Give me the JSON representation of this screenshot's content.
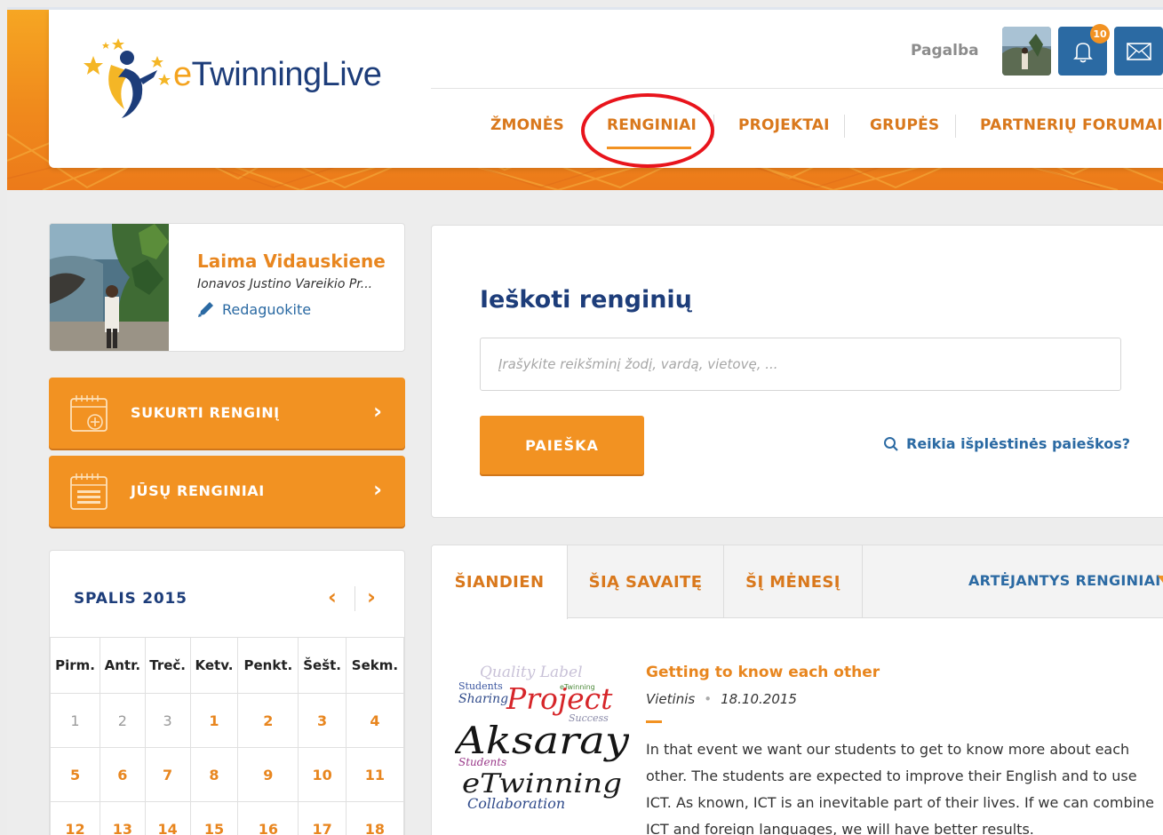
{
  "header": {
    "logo_text_e": "e",
    "logo_text_rest": "TwinningLive",
    "help_link": "Pagalba",
    "notification_count": "10"
  },
  "nav": {
    "items": [
      {
        "label": "ŽMONĖS"
      },
      {
        "label": "RENGINIAI"
      },
      {
        "label": "PROJEKTAI"
      },
      {
        "label": "GRUPĖS"
      },
      {
        "label": "PARTNERIŲ FORUMAI"
      }
    ],
    "active_index": 1
  },
  "profile": {
    "name": "Laima Vidauskiene",
    "school": "Ionavos Justino Vareikio Pr...",
    "edit_label": "Redaguokite"
  },
  "actions": {
    "create_event": "SUKURTI RENGINĮ",
    "your_events": "JŪSŲ RENGINIAI"
  },
  "calendar": {
    "title": "SPALIS 2015",
    "weekdays": [
      "Pirm.",
      "Antr.",
      "Treč.",
      "Ketv.",
      "Penkt.",
      "Šešt.",
      "Sekm."
    ],
    "weeks": [
      [
        {
          "d": "1",
          "m": true
        },
        {
          "d": "2",
          "m": true
        },
        {
          "d": "3",
          "m": true
        },
        {
          "d": "1",
          "m": false
        },
        {
          "d": "2",
          "m": false
        },
        {
          "d": "3",
          "m": false
        },
        {
          "d": "4",
          "m": false
        }
      ],
      [
        {
          "d": "5",
          "m": false
        },
        {
          "d": "6",
          "m": false
        },
        {
          "d": "7",
          "m": false
        },
        {
          "d": "8",
          "m": false
        },
        {
          "d": "9",
          "m": false
        },
        {
          "d": "10",
          "m": false
        },
        {
          "d": "11",
          "m": false
        }
      ],
      [
        {
          "d": "12",
          "m": false
        },
        {
          "d": "13",
          "m": false
        },
        {
          "d": "14",
          "m": false
        },
        {
          "d": "15",
          "m": false
        },
        {
          "d": "16",
          "m": false
        },
        {
          "d": "17",
          "m": false
        },
        {
          "d": "18",
          "m": false
        }
      ]
    ]
  },
  "search": {
    "title": "Ieškoti renginių",
    "placeholder": "Įrašykite reikšminį žodį, vardą, vietovę, ...",
    "button": "PAIEŠKA",
    "advanced_link": "Reikia išplėstinės paieškos?"
  },
  "events": {
    "tabs": [
      "ŠIANDIEN",
      "ŠIĄ SAVAITĘ",
      "ŠĮ MĖNESĮ"
    ],
    "upcoming_label": "ARTĖJANTYS RENGINIAI",
    "items": [
      {
        "title": "Getting to know each other",
        "type": "Vietinis",
        "date": "18.10.2015",
        "description": "In that event we want our students to get to know more about each other. The students are expected to improve their English and to use ICT. As known, ICT is an inevitable part of their lives. If we can combine ICT and foreign languages, we will have better results.",
        "image_words": [
          "Quality Label",
          "Students",
          "eTwinning",
          "Sharing",
          "Project",
          "Success",
          "Aksaray",
          "Students",
          "eTwinning",
          "Collaboration"
        ]
      }
    ]
  },
  "colors": {
    "brand_orange": "#f29222",
    "brand_blue": "#1d3d7a",
    "link_blue": "#2b6aa3",
    "highlight_red": "#e8141c"
  }
}
